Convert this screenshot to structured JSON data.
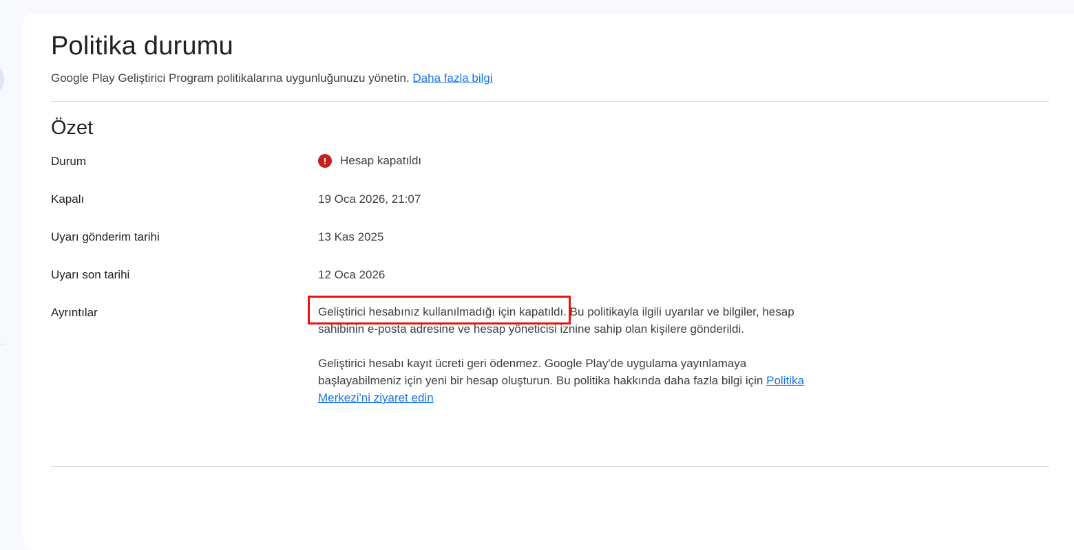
{
  "header": {
    "title": "Politika durumu",
    "subtitle": "Google Play Geliştirici Program politikalarına uygunluğunuzu yönetin.",
    "learn_more": "Daha fazla bilgi"
  },
  "summary": {
    "title": "Özet",
    "status": {
      "label": "Durum",
      "value": "Hesap kapatıldı",
      "icon": "error-icon",
      "color": "#c5221f"
    },
    "closed": {
      "label": "Kapalı",
      "value": "19 Oca 2026, 21:07"
    },
    "warning_sent": {
      "label": "Uyarı gönderim tarihi",
      "value": "13 Kas 2025"
    },
    "warning_deadline": {
      "label": "Uyarı son tarihi",
      "value": "12 Oca 2026"
    },
    "details": {
      "label": "Ayrıntılar",
      "highlighted": "Geliştirici hesabınız kullanılmadığı için kapatıldı.",
      "p1_rest": " Bu politikayla ilgili uyarılar ve bilgiler, hesap sahibinin e-posta adresine ve hesap yöneticisi iznine sahip olan kişilere gönderildi.",
      "p2": "Geliştirici hesabı kayıt ücreti geri ödenmez. Google Play'de uygulama yayınlamaya başlayabilmeniz için yeni bir hesap oluşturun. Bu politika hakkında daha fazla bilgi için ",
      "policy_link": "Politika Merkezi'ni ziyaret edin"
    }
  },
  "colors": {
    "link": "#1a73e8",
    "annotation": "#e8130f"
  }
}
